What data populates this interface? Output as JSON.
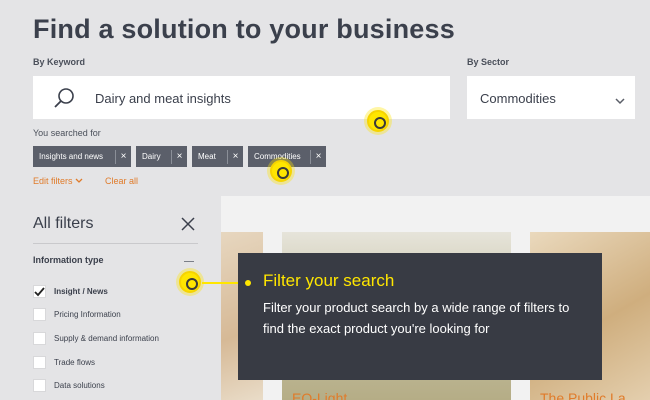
{
  "title": "Find a solution to your business",
  "keyword": {
    "label": "By Keyword",
    "value": "Dairy and meat insights"
  },
  "sector": {
    "label": "By Sector",
    "value": "Commodities"
  },
  "searched": {
    "label": "You searched for",
    "chips": [
      "Insights and news",
      "Dairy",
      "Meat",
      "Commodities"
    ],
    "remove_glyph": "×"
  },
  "links": {
    "edit": "Edit filters",
    "clear": "Clear all"
  },
  "filters": {
    "heading": "All filters",
    "close_glyph": "×",
    "section": "Information type",
    "options": [
      {
        "label": "Insight / News",
        "checked": true
      },
      {
        "label": "Pricing Information",
        "checked": false
      },
      {
        "label": "Supply & demand information",
        "checked": false
      },
      {
        "label": "Trade flows",
        "checked": false
      },
      {
        "label": "Data solutions",
        "checked": false
      }
    ]
  },
  "cards": {
    "titles": [
      "EQ-Light",
      "The Public La"
    ]
  },
  "tooltip": {
    "title": "Filter your search",
    "text": "Filter your product search by a wide range of filters to find the exact product you're looking for"
  },
  "colors": {
    "accent": "#e07b2a",
    "highlight": "#ffe600",
    "tooltip_bg": "#383b44",
    "chip_bg": "#5b5f6a"
  },
  "icons": {
    "search": "magnifier-icon",
    "dropdown": "chevron-down-icon",
    "close": "close-icon",
    "check": "checkmark-icon"
  }
}
